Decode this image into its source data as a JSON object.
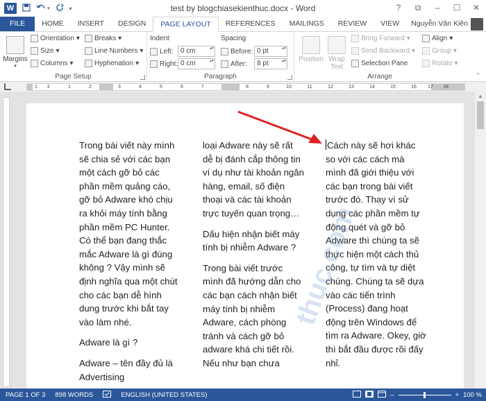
{
  "window": {
    "title": "test by blogchiasekienthuc.docx - Word",
    "app_logo": "W",
    "quick_access": [
      "save-icon",
      "undo-icon",
      "redo-icon"
    ],
    "controls": [
      "?",
      "⧉",
      "–",
      "☐",
      "✕"
    ]
  },
  "tabs": [
    {
      "label": "FILE"
    },
    {
      "label": "HOME"
    },
    {
      "label": "INSERT"
    },
    {
      "label": "DESIGN"
    },
    {
      "label": "PAGE LAYOUT"
    },
    {
      "label": "REFERENCES"
    },
    {
      "label": "MAILINGS"
    },
    {
      "label": "REVIEW"
    },
    {
      "label": "VIEW"
    }
  ],
  "user_name": "Nguyễn Văn Kiên",
  "ribbon": {
    "page_setup": {
      "label": "Page Setup",
      "margins": "Margins",
      "orientation": "Orientation",
      "size": "Size",
      "columns": "Columns",
      "breaks": "Breaks",
      "line_numbers": "Line Numbers",
      "hyphenation": "Hyphenation"
    },
    "paragraph": {
      "label": "Paragraph",
      "indent": "Indent",
      "spacing": "Spacing",
      "left_label": "Left:",
      "left_value": "0 cm",
      "right_label": "Right:",
      "right_value": "0 cm",
      "before_label": "Before:",
      "before_value": "0 pt",
      "after_label": "After:",
      "after_value": "8 pt"
    },
    "arrange": {
      "label": "Arrange",
      "position": "Position",
      "wrap_text_1": "Wrap",
      "wrap_text_2": "Text",
      "bring_forward": "Bring Forward",
      "send_backward": "Send Backward",
      "selection_pane": "Selection Pane",
      "align": "Align",
      "group": "Group",
      "rotate": "Rotate"
    }
  },
  "ruler": {
    "numbers": [
      "1",
      "2",
      "1",
      "2",
      "3",
      "4",
      "5",
      "6",
      "7",
      "8",
      "9",
      "10",
      "11",
      "12",
      "13",
      "14",
      "15",
      "16",
      "17",
      "18"
    ]
  },
  "document": {
    "col1": [
      "Trong bài viết này mình sẽ chia sẻ với các bạn một cách gỡ bỏ các phần mềm quảng cáo, gỡ bỏ Adware khó chịu ra khỏi máy tính bằng phần mềm PC Hunter. Có thể bạn đang thắc mắc Adware là gì đúng không ? Vậy mình sẽ định nghĩa qua một chút cho các bạn dễ hình dung trước khi bắt tay vào làm nhé.",
      "Adware là gì ?",
      "Adware – tên đầy đủ là Advertising"
    ],
    "col2": [
      "loại Adware này sẽ rất dễ bị đánh cắp thông tin ví dụ như tài khoản ngân hàng, email, số điện thoại và các tài khoản trực tuyến quan trọng…",
      "Dấu hiện nhận biết máy tính bị nhiễm Adware ?",
      "Trong bài viết trước mình đã hướng dẫn cho các bạn cách nhận biết máy tính bị nhiễm Adware, cách phòng tránh và cách gỡ bỏ adware khá chi tiết rồi. Nếu như bạn chưa"
    ],
    "col3": [
      "Cách này sẽ hơi khác so với các cách mà mình đã giới thiệu với các bạn trong bài viết trước đó. Thay vì sử dụng các phần mềm tự động quét và gỡ bỏ Adware thì chúng ta sẽ thực hiện một cách thủ công, tự tìm và tự diệt chúng. Chúng ta sẽ dựa vào các tiến trình (Process) đang hoạt động trên Windows để tìm ra Adware. Okey, giờ thì bắt đầu được rồi đấy nhỉ."
    ],
    "watermark": "thuc.com"
  },
  "status": {
    "page": "PAGE 1 OF 3",
    "words": "898 WORDS",
    "language": "ENGLISH (UNITED STATES)",
    "zoom": "100 %",
    "zoom_minus": "–",
    "zoom_plus": "+"
  },
  "colors": {
    "word_blue": "#2b579a",
    "arrow_red": "#e02020"
  }
}
